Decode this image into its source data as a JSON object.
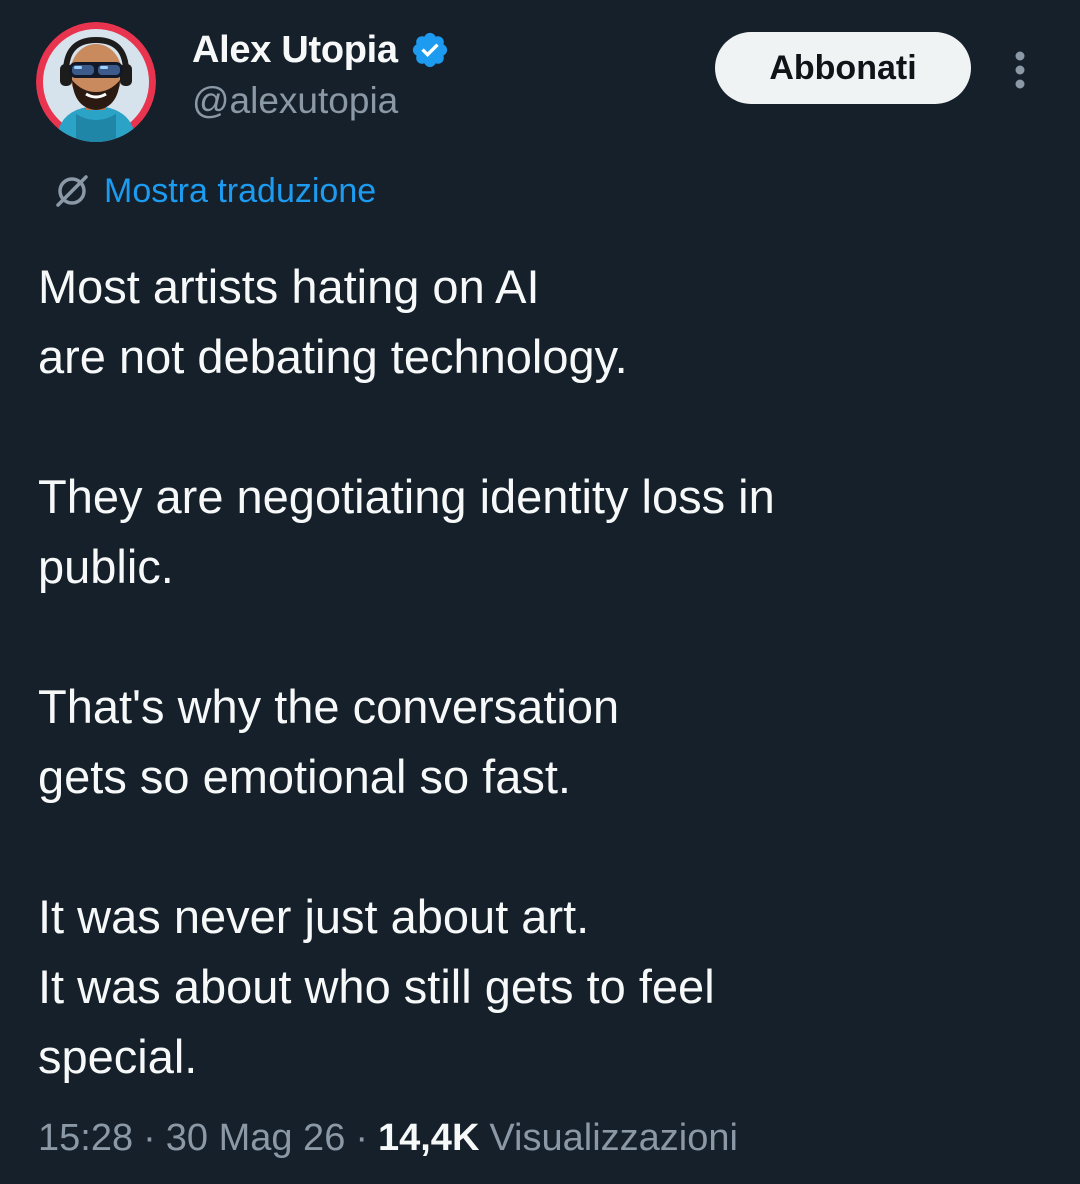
{
  "author": {
    "display_name": "Alex Utopia",
    "handle": "@alexutopia",
    "avatar_icon": "avatar-image",
    "verified_icon": "verified-badge-icon",
    "verified_color": "#1d9bf0"
  },
  "actions": {
    "subscribe_label": "Abbonati",
    "more_icon": "more-vertical-icon"
  },
  "translation": {
    "icon": "translate-globe-icon",
    "label": "Mostra traduzione",
    "color": "#1d9bf0"
  },
  "tweet": {
    "paragraphs": [
      [
        "Most artists hating on AI",
        "are not debating technology."
      ],
      [
        "They are negotiating identity loss in",
        "public."
      ],
      [
        "That's why the conversation",
        "gets so emotional so fast."
      ],
      [
        "It was never just about art.",
        "It was about who still gets to feel",
        "special."
      ]
    ]
  },
  "meta": {
    "time": "15:28",
    "separator": "·",
    "date": "30 Mag 26",
    "views_count": "14,4K",
    "views_label": "Visualizzazioni"
  },
  "colors": {
    "background": "#15202b",
    "text_primary": "#f7f9f9",
    "text_secondary": "#8b98a5",
    "button_background": "#eff3f4"
  }
}
